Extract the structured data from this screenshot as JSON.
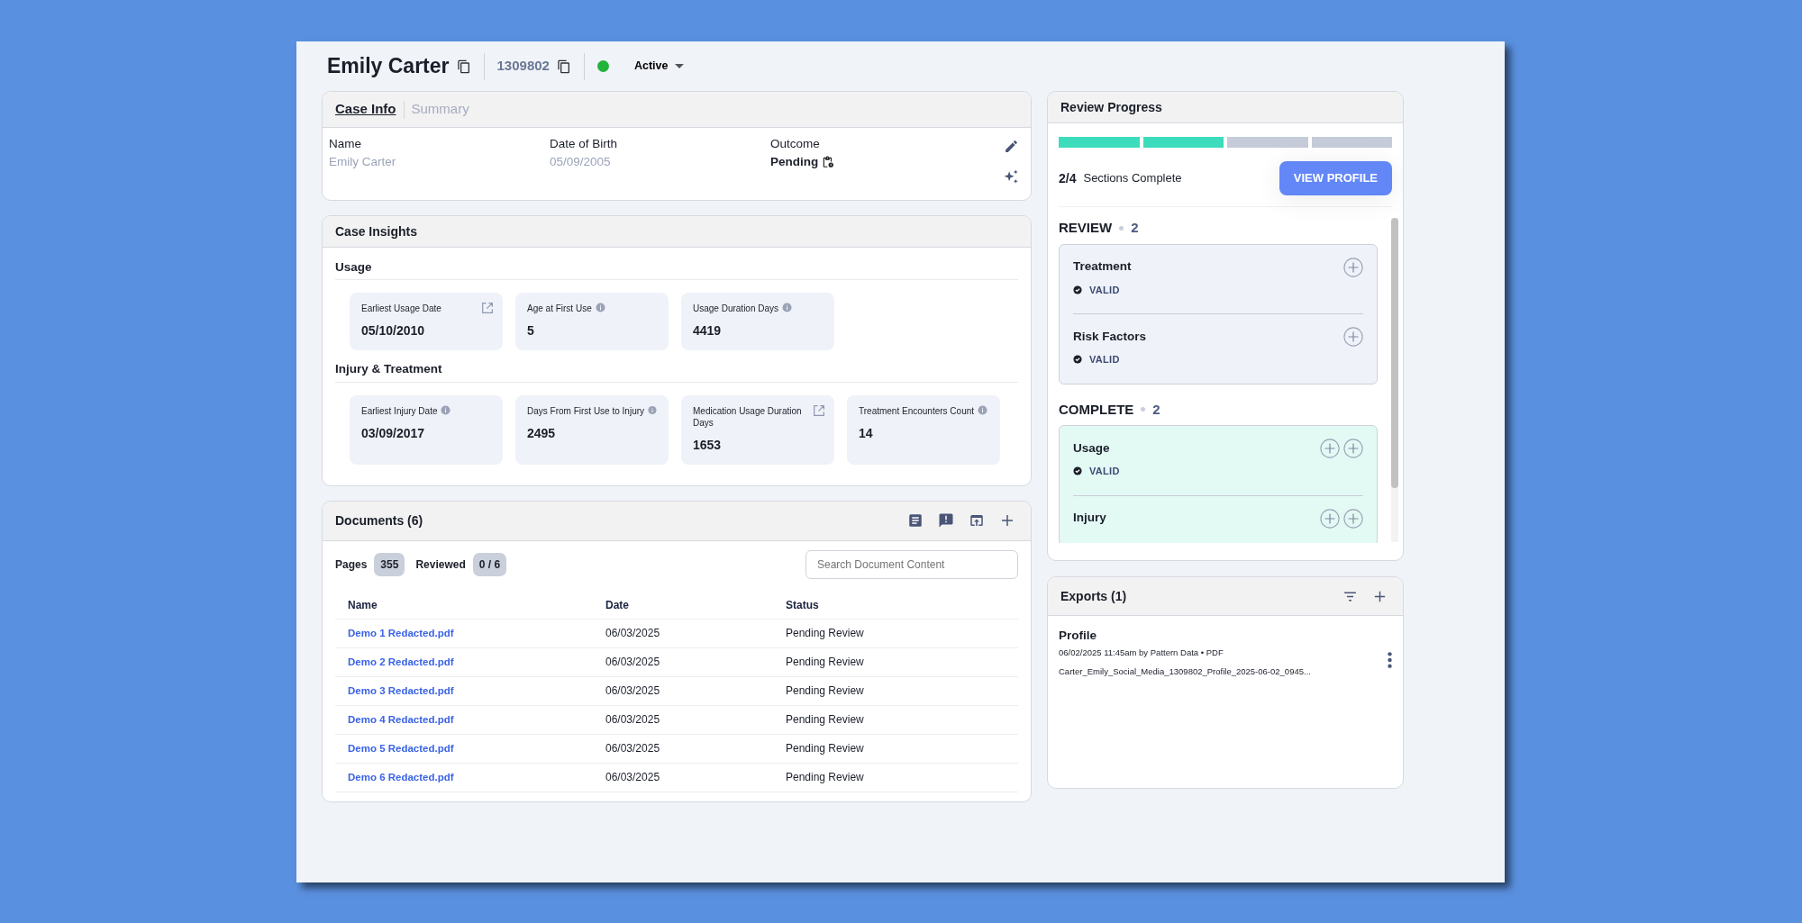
{
  "header": {
    "name": "Emily Carter",
    "case_id": "1309802",
    "status": {
      "label": "Active",
      "color": "#22b33a"
    }
  },
  "case_info": {
    "tabs": [
      {
        "label": "Case Info",
        "selected": true
      },
      {
        "label": "Summary",
        "selected": false
      }
    ],
    "fields": [
      {
        "label": "Name",
        "value": "Emily Carter",
        "kind": "muted"
      },
      {
        "label": "Date of Birth",
        "value": "05/09/2005",
        "kind": "muted"
      },
      {
        "label": "Outcome",
        "value": "Pending",
        "kind": "status"
      }
    ]
  },
  "case_insights": {
    "title": "Case Insights",
    "groups": [
      {
        "title": "Usage",
        "metrics": [
          {
            "label": "Earliest Usage Date",
            "value": "05/10/2010",
            "kind": "link"
          },
          {
            "label": "Age at First Use",
            "value": "5",
            "kind": "info"
          },
          {
            "label": "Usage Duration Days",
            "value": "4419",
            "kind": "info"
          }
        ]
      },
      {
        "title": "Injury & Treatment",
        "metrics": [
          {
            "label": "Earliest Injury Date",
            "value": "03/09/2017",
            "kind": "info"
          },
          {
            "label": "Days From First Use to Injury",
            "value": "2495",
            "kind": "info"
          },
          {
            "label": "Medication Usage Duration Days",
            "value": "1653",
            "kind": "link"
          },
          {
            "label": "Treatment Encounters Count",
            "value": "14",
            "kind": "info"
          }
        ]
      }
    ]
  },
  "documents": {
    "title": "Documents (6)",
    "pages_label": "Pages",
    "pages": "355",
    "reviewed_label": "Reviewed",
    "reviewed": "0 / 6",
    "search": {
      "placeholder": "Search Document Content"
    },
    "table": {
      "columns": [
        "Name",
        "Date",
        "Status"
      ],
      "rows": [
        [
          "Demo 1 Redacted.pdf",
          "06/03/2025",
          "Pending Review"
        ],
        [
          "Demo 2 Redacted.pdf",
          "06/03/2025",
          "Pending Review"
        ],
        [
          "Demo 3 Redacted.pdf",
          "06/03/2025",
          "Pending Review"
        ],
        [
          "Demo 4 Redacted.pdf",
          "06/03/2025",
          "Pending Review"
        ],
        [
          "Demo 5 Redacted.pdf",
          "06/03/2025",
          "Pending Review"
        ],
        [
          "Demo 6 Redacted.pdf",
          "06/03/2025",
          "Pending Review"
        ]
      ]
    }
  },
  "review_progress": {
    "title": "Review Progress",
    "segments": [
      {
        "complete": true
      },
      {
        "complete": true
      },
      {
        "complete": false
      },
      {
        "complete": false
      }
    ],
    "count": "2/4",
    "count_label": "Sections Complete",
    "button": "VIEW PROFILE",
    "groups": [
      {
        "title": "REVIEW",
        "count": "2",
        "kind": "review",
        "items": [
          {
            "name": "Treatment",
            "status": "VALID"
          },
          {
            "name": "Risk Factors",
            "status": "VALID"
          }
        ]
      },
      {
        "title": "COMPLETE",
        "count": "2",
        "kind": "complete",
        "items": [
          {
            "name": "Usage",
            "status": "VALID"
          },
          {
            "name": "Injury"
          }
        ]
      }
    ]
  },
  "exports": {
    "title": "Exports (1)",
    "items": [
      {
        "title": "Profile",
        "meta": "06/02/2025 11:45am by Pattern Data • PDF",
        "file": "Carter_Emily_Social_Media_1309802_Profile_2025-06-02_0945..."
      }
    ]
  }
}
